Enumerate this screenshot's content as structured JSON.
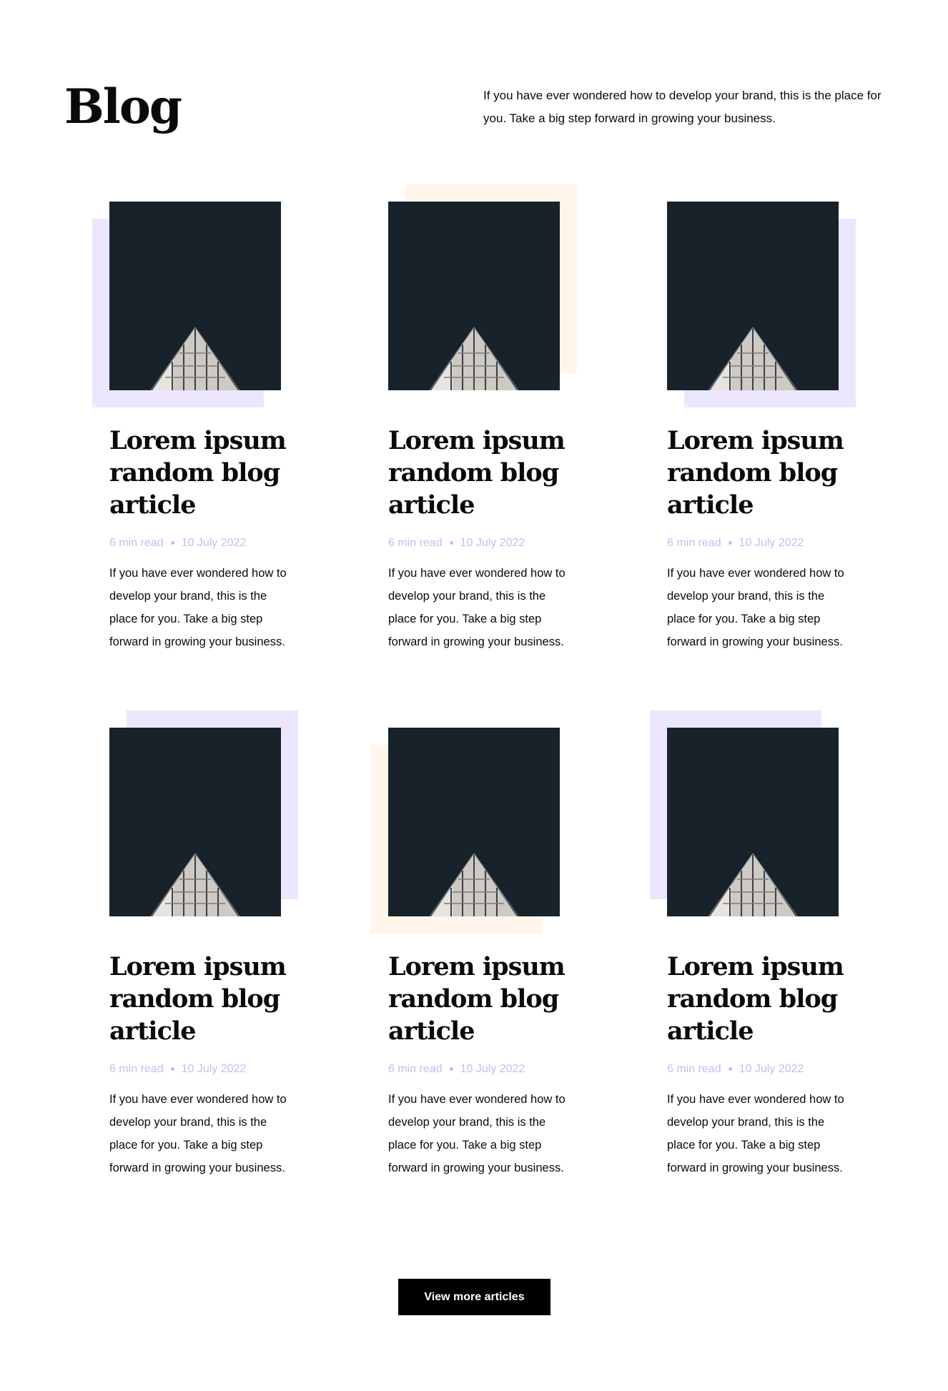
{
  "header": {
    "title": "Blog",
    "intro": "If you have ever wondered how to develop your brand, this is the place for you. Take a big step forward in growing your business."
  },
  "colors": {
    "lavender": "#ece6fd",
    "peach": "#fff5eb",
    "image_bg": "#17222b",
    "meta_text": "#c6bcf1",
    "button_bg": "#000000"
  },
  "articles": [
    {
      "title": "Lorem ipsum random blog article",
      "read_time": "6 min read",
      "date": "10 July 2022",
      "excerpt": "If you have ever wondered how to develop your brand, this is the place for you. Take a big step forward in growing your business.",
      "image": "building-photo",
      "accent_color": "lavender"
    },
    {
      "title": "Lorem ipsum random blog article",
      "read_time": "6 min read",
      "date": "10 July 2022",
      "excerpt": "If you have ever wondered how to develop your brand, this is the place for you. Take a big step forward in growing your business.",
      "image": "building-photo",
      "accent_color": "peach"
    },
    {
      "title": "Lorem ipsum random blog article",
      "read_time": "6 min read",
      "date": "10 July 2022",
      "excerpt": "If you have ever wondered how to develop your brand, this is the place for you. Take a big step forward in growing your business.",
      "image": "building-photo",
      "accent_color": "lavender"
    },
    {
      "title": "Lorem ipsum random blog article",
      "read_time": "6 min read",
      "date": "10 July 2022",
      "excerpt": "If you have ever wondered how to develop your brand, this is the place for you. Take a big step forward in growing your business.",
      "image": "building-photo",
      "accent_color": "lavender"
    },
    {
      "title": "Lorem ipsum random blog article",
      "read_time": "6 min read",
      "date": "10 July 2022",
      "excerpt": "If you have ever wondered how to develop your brand, this is the place for you. Take a big step forward in growing your business.",
      "image": "building-photo",
      "accent_color": "peach"
    },
    {
      "title": "Lorem ipsum random blog article",
      "read_time": "6 min read",
      "date": "10 July 2022",
      "excerpt": "If you have ever wondered how to develop your brand, this is the place for you. Take a big step forward in growing your business.",
      "image": "building-photo",
      "accent_color": "lavender"
    }
  ],
  "footer": {
    "button_label": "View more articles"
  }
}
